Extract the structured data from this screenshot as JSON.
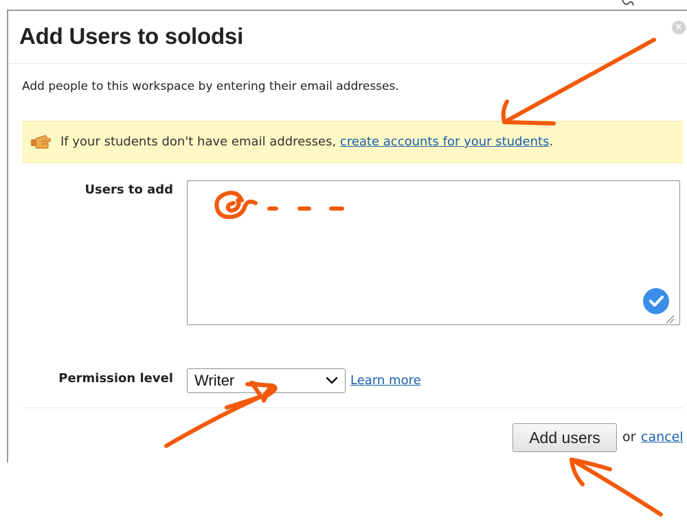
{
  "dialog": {
    "title": "Add Users to solodsi",
    "close_icon": "close-circle-icon",
    "intro": "Add people to this workspace by entering their email addresses."
  },
  "notice": {
    "icon": "pointing-hand-icon",
    "text_before": "If your students don't have email addresses, ",
    "link_text": "create accounts for your students",
    "text_after": "."
  },
  "form": {
    "users_label": "Users to add",
    "users_value": "",
    "permission_label": "Permission level",
    "permission_value": "Writer",
    "learn_more": "Learn more"
  },
  "actions": {
    "add_button": "Add users",
    "or_text": "or",
    "cancel_link": "cancel"
  },
  "annotations": {
    "handwritten_text": "@ - - -",
    "color": "#f25a0a"
  },
  "colors": {
    "notice_bg": "#fdf8c4",
    "link": "#1a5eae",
    "check_badge": "#3a8ee8"
  }
}
